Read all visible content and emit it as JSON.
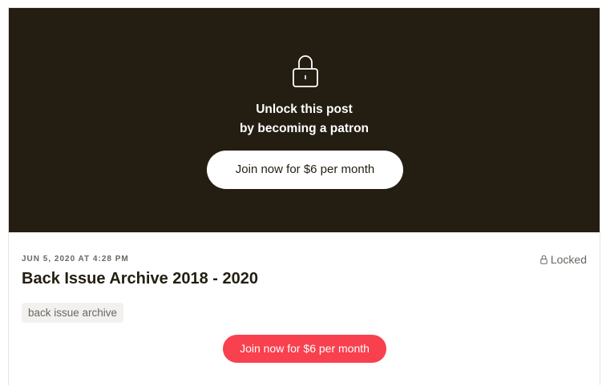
{
  "hero": {
    "lock_icon": "padlock-icon",
    "line1": "Unlock this post",
    "line2": "by becoming a patron",
    "join_label": "Join now for $6 per month"
  },
  "post": {
    "date": "JUN 5, 2020 AT 4:28 PM",
    "status": "Locked",
    "status_icon": "small-lock-icon",
    "title": "Back Issue Archive 2018 - 2020",
    "tag": "back issue archive",
    "join_label": "Join now for $6 per month"
  },
  "colors": {
    "hero_bg": "#241e12",
    "accent": "#f9404e",
    "muted_text": "#6b6660",
    "tag_bg": "#f2f1ef"
  }
}
